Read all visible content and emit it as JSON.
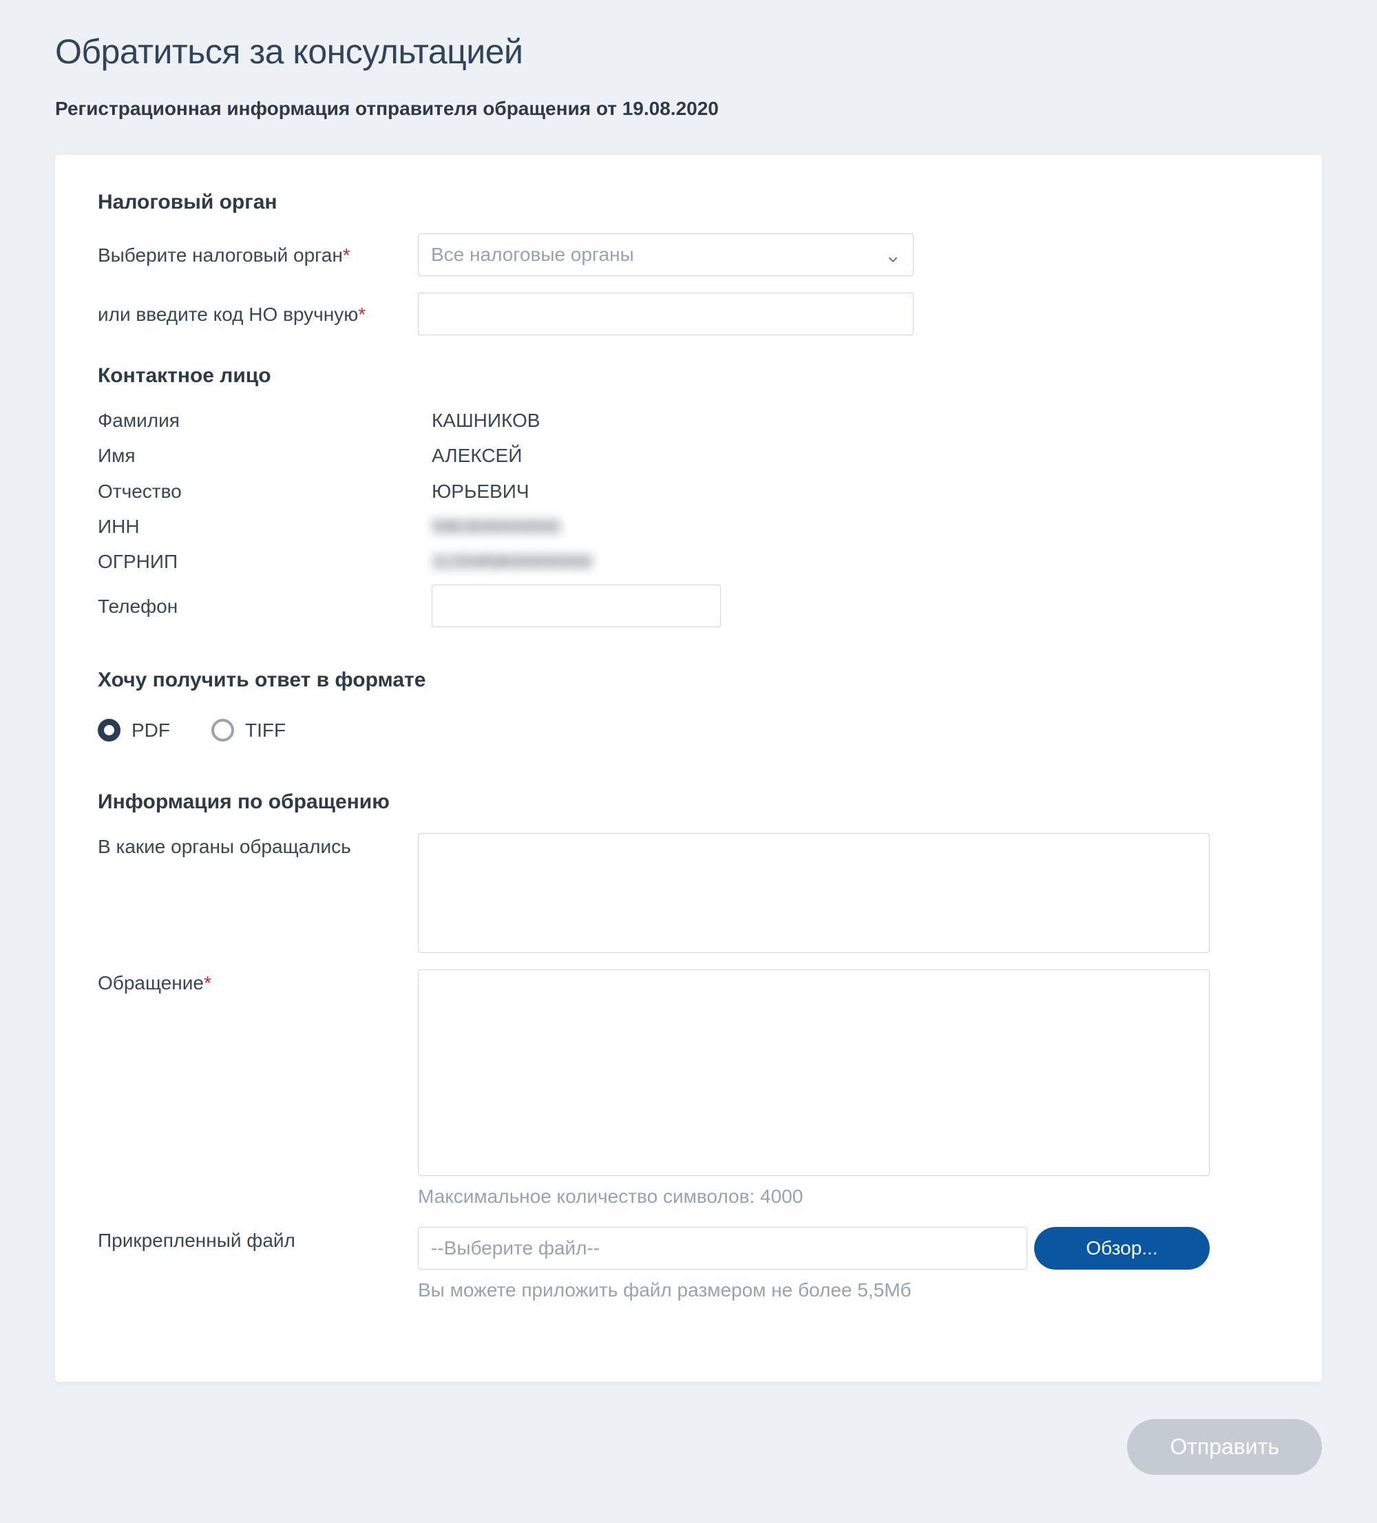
{
  "header": {
    "title": "Обратиться за консультацией",
    "subtitle": "Регистрационная информация отправителя обращения от 19.08.2020"
  },
  "tax_authority": {
    "section_title": "Налоговый орган",
    "select_label": "Выберите налоговый орган",
    "select_placeholder": "Все налоговые органы",
    "manual_label": "или введите код НО вручную",
    "manual_value": ""
  },
  "contact": {
    "section_title": "Контактное лицо",
    "surname_label": "Фамилия",
    "surname_value": "КАШНИКОВ",
    "firstname_label": "Имя",
    "firstname_value": "АЛЕКСЕЙ",
    "patronymic_label": "Отчество",
    "patronymic_value": "ЮРЬЕВИЧ",
    "inn_label": "ИНН",
    "inn_value": "590300000000",
    "ogrnip_label": "ОГРНИП",
    "ogrnip_value": "315595800000000",
    "phone_label": "Телефон",
    "phone_value": ""
  },
  "format": {
    "section_title": "Хочу получить ответ в формате",
    "options": {
      "pdf": "PDF",
      "tiff": "TIFF"
    },
    "selected": "pdf"
  },
  "request": {
    "section_title": "Информация по обращению",
    "prev_label": "В какие органы обращались",
    "prev_value": "",
    "body_label": "Обращение",
    "body_value": "",
    "body_help": "Максимальное количество символов: 4000",
    "file_label": "Прикрепленный файл",
    "file_placeholder": "--Выберите файл--",
    "browse_label": "Обзор...",
    "file_help": "Вы можете приложить файл размером не более 5,5Мб"
  },
  "actions": {
    "submit": "Отправить"
  }
}
